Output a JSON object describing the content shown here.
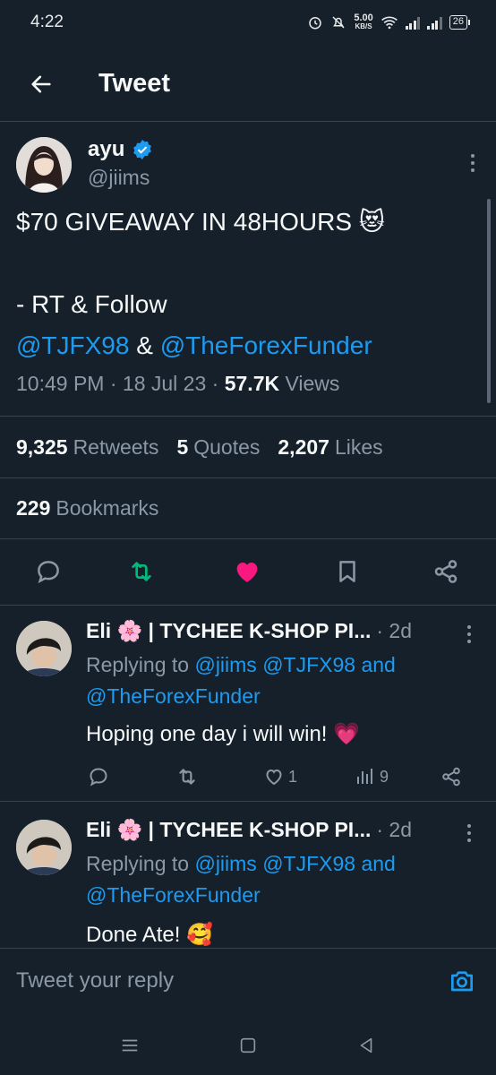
{
  "status_bar": {
    "time": "4:22",
    "net_speed": "5.00",
    "net_unit": "KB/S",
    "battery": "26"
  },
  "header": {
    "title": "Tweet"
  },
  "tweet": {
    "author_name": "ayu",
    "author_handle": "@jiims",
    "text_line1": "$70 GIVEAWAY IN 48HOURS 😻",
    "text_line2": "- RT & Follow",
    "mention1": "@TJFX98",
    "amp": " & ",
    "mention2": "@TheForexFunder",
    "time": "10:49 PM",
    "date": "18 Jul 23",
    "views_count": "57.7K",
    "views_label": "Views",
    "retweets_count": "9,325",
    "retweets_label": "Retweets",
    "quotes_count": "5",
    "quotes_label": "Quotes",
    "likes_count": "2,207",
    "likes_label": "Likes",
    "bookmarks_count": "229",
    "bookmarks_label": "Bookmarks"
  },
  "replies": [
    {
      "name": "Eli 🌸 | TYCHEE K-SHOP PI...",
      "time": "· 2d",
      "replying_prefix": "Replying to",
      "replying_1": "@jiims @TJFX98 and",
      "replying_2": "@TheForexFunder",
      "text": "Hoping one day i will win! 💗",
      "likes": "1",
      "views": "9"
    },
    {
      "name": "Eli 🌸 | TYCHEE K-SHOP PI...",
      "time": "· 2d",
      "replying_prefix": "Replying to",
      "replying_1": "@jiims @TJFX98 and",
      "replying_2": "@TheForexFunder",
      "text": "Done Ate! 🥰"
    }
  ],
  "compose": {
    "placeholder": "Tweet your reply"
  },
  "colors": {
    "background": "#15202b",
    "link": "#1d9bf0",
    "retweeted": "#00ba7c",
    "liked": "#f91880",
    "muted": "#8b98a5"
  },
  "icons": [
    "back-arrow-icon",
    "verified-badge-icon",
    "more-icon",
    "reply-icon",
    "retweet-icon",
    "heart-icon",
    "bookmark-icon",
    "share-icon",
    "views-icon",
    "camera-icon",
    "menu-icon",
    "home-icon",
    "back-icon"
  ]
}
